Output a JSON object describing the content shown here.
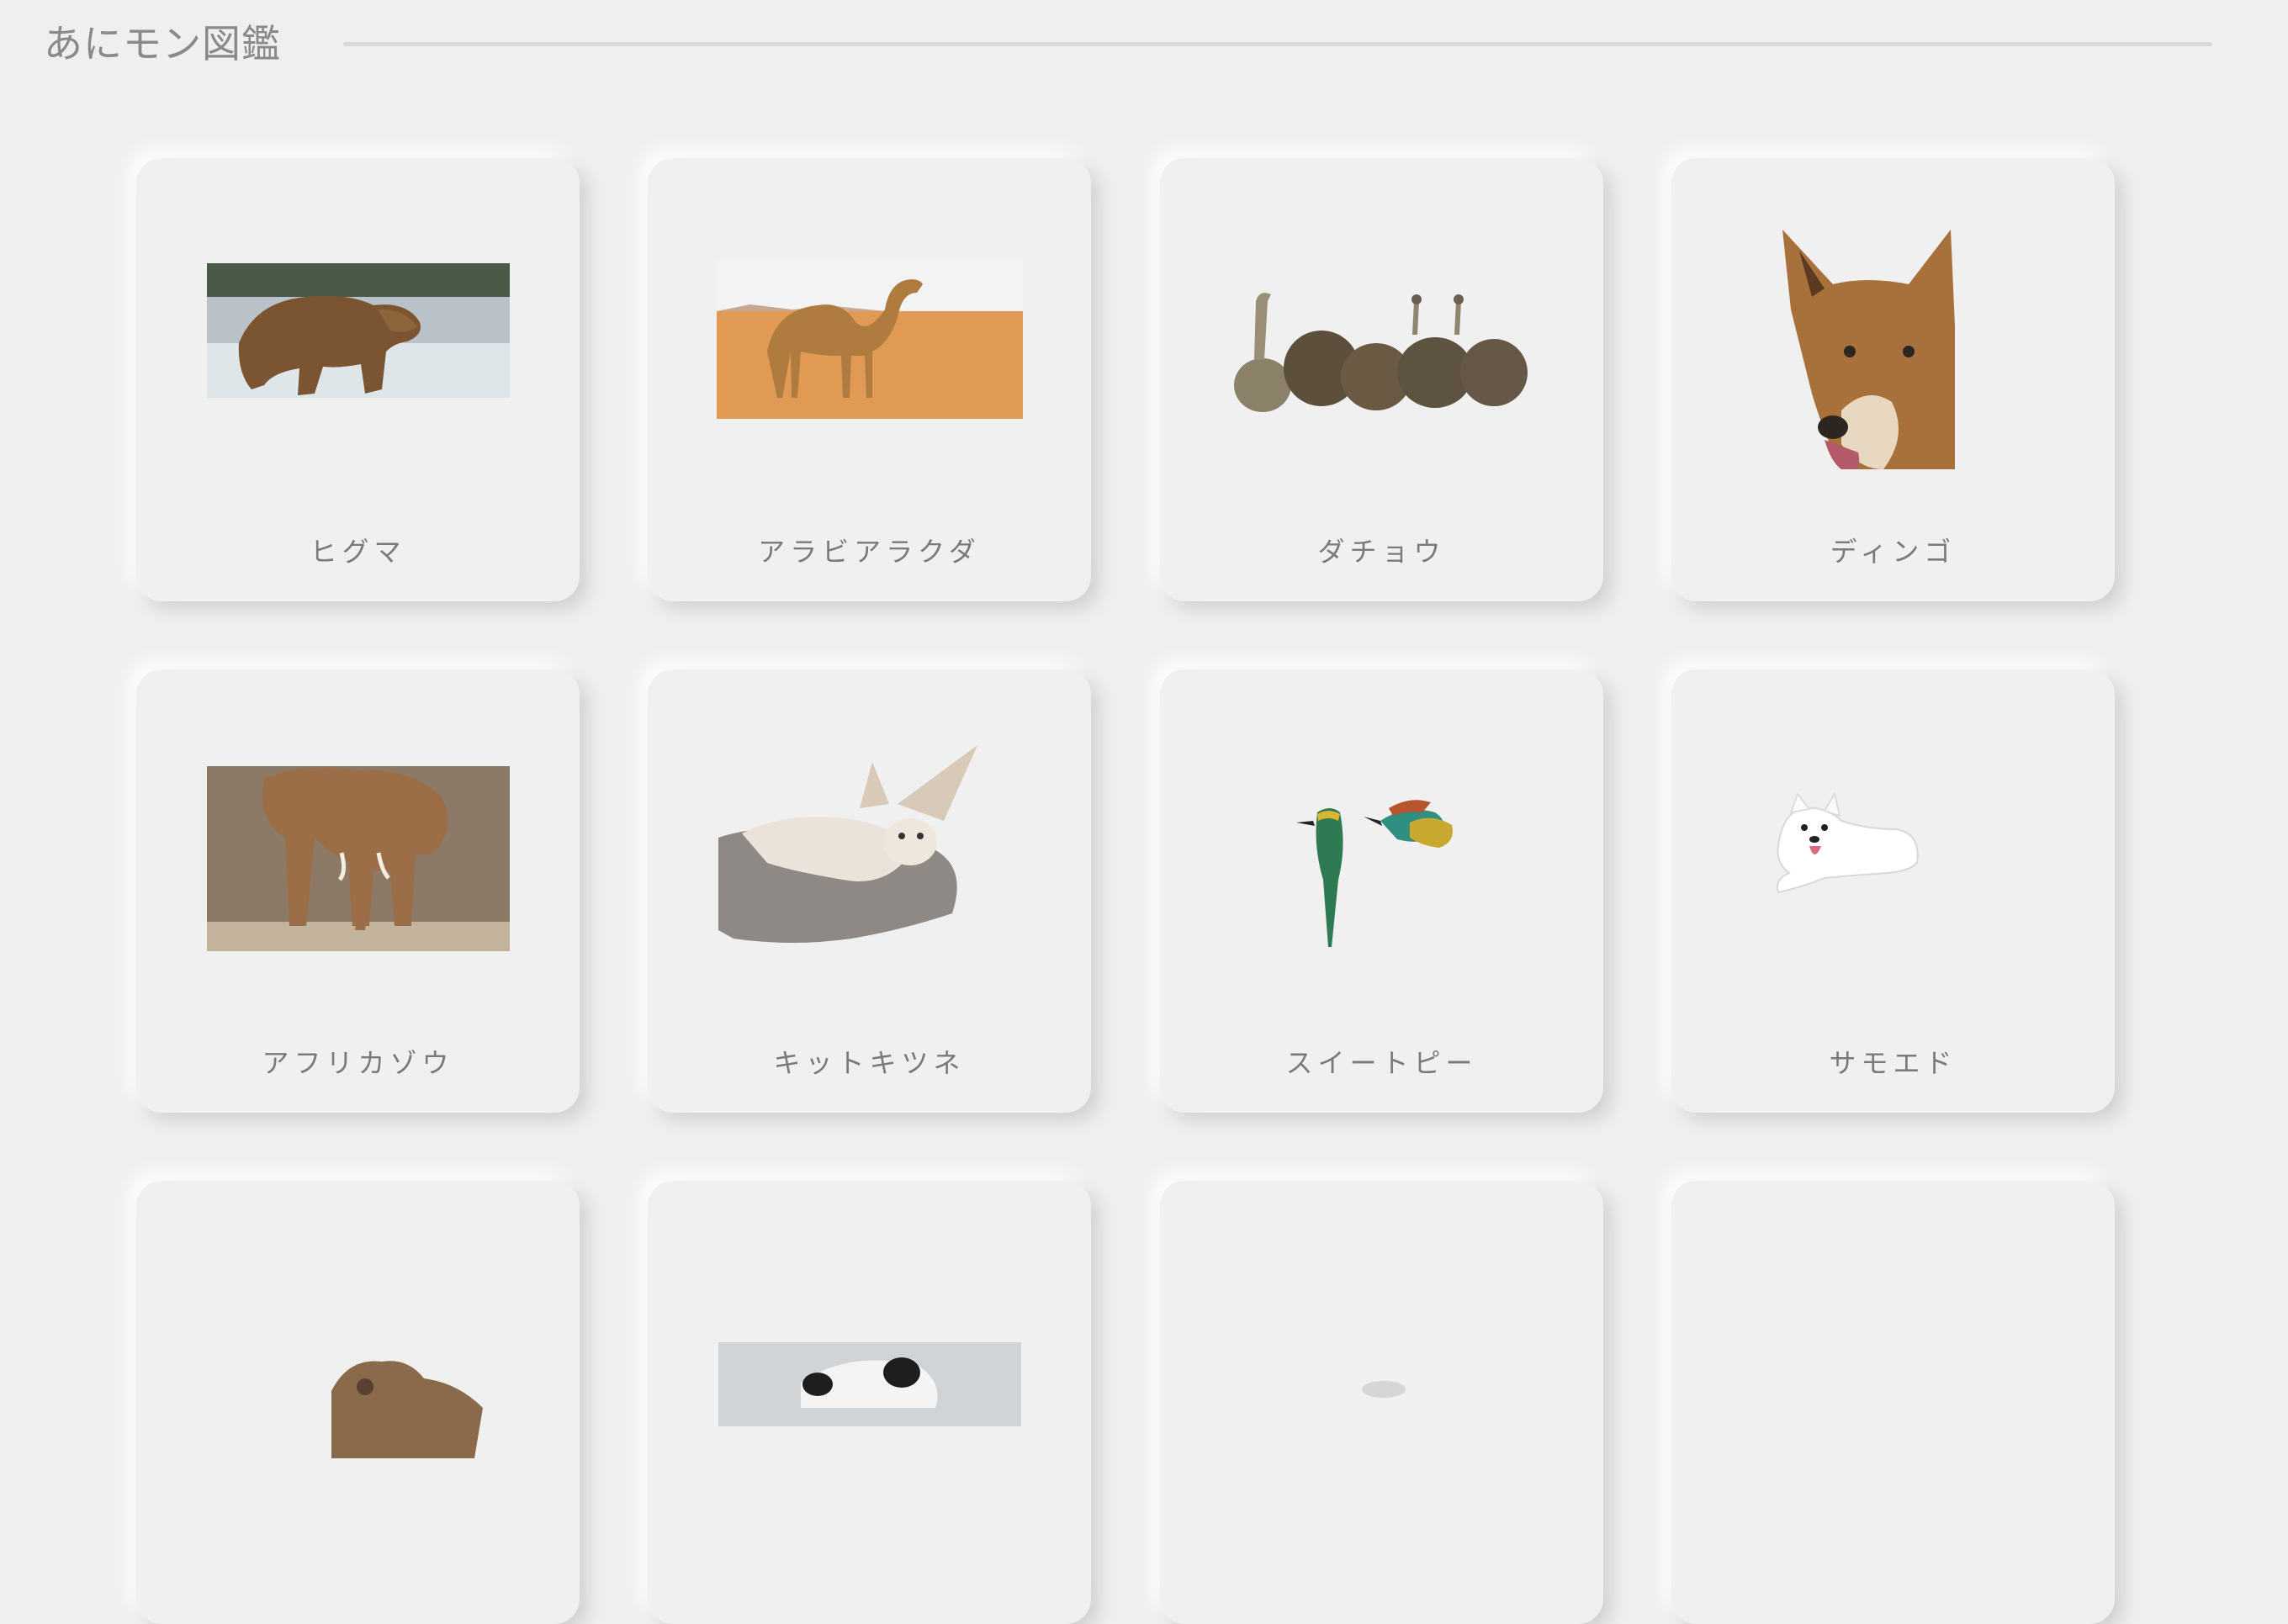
{
  "header": {
    "title": "あにモン図鑑"
  },
  "cards": [
    {
      "name": "ヒグマ",
      "icon": "brown-bear-photo"
    },
    {
      "name": "アラビアラクダ",
      "icon": "camel-photo"
    },
    {
      "name": "ダチョウ",
      "icon": "ostrich-photo"
    },
    {
      "name": "ディンゴ",
      "icon": "dingo-photo"
    },
    {
      "name": "アフリカゾウ",
      "icon": "elephant-photo"
    },
    {
      "name": "キットキツネ",
      "icon": "kit-fox-photo"
    },
    {
      "name": "スイートピー",
      "icon": "bee-eater-photo"
    },
    {
      "name": "サモエド",
      "icon": "samoyed-photo"
    },
    {
      "name": "",
      "icon": "bear-photo"
    },
    {
      "name": "",
      "icon": "panda-photo"
    },
    {
      "name": "",
      "icon": "animal-photo"
    },
    {
      "name": "",
      "icon": "animal-photo"
    }
  ],
  "colors": {
    "background": "#efefef",
    "card": "#f0f0f0",
    "title": "#8a8a8a",
    "label": "#7a7a7a"
  }
}
